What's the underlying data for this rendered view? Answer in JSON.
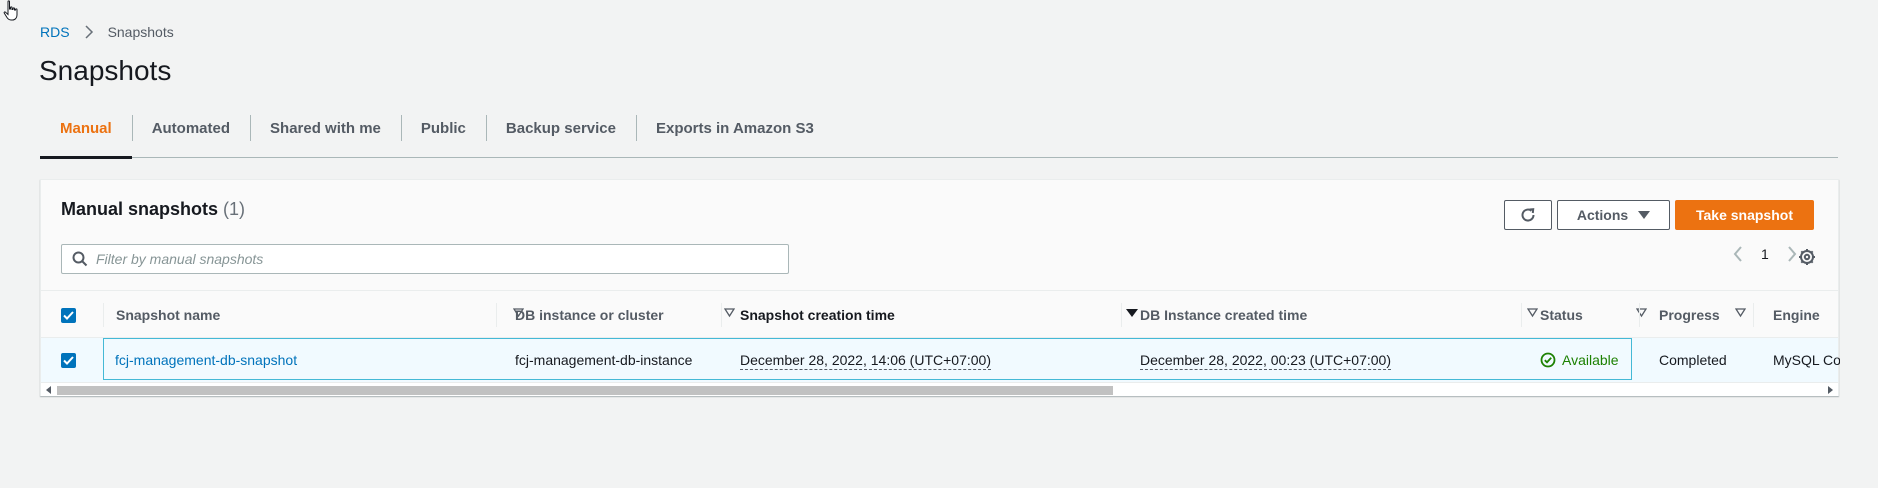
{
  "breadcrumb": {
    "parent": "RDS",
    "current": "Snapshots"
  },
  "page_title": "Snapshots",
  "tabs": [
    {
      "label": "Manual",
      "active": true
    },
    {
      "label": "Automated"
    },
    {
      "label": "Shared with me"
    },
    {
      "label": "Public"
    },
    {
      "label": "Backup service"
    },
    {
      "label": "Exports in Amazon S3"
    }
  ],
  "panel": {
    "title": "Manual snapshots",
    "count": "(1)",
    "actions_label": "Actions",
    "primary_label": "Take snapshot",
    "search_placeholder": "Filter by manual snapshots",
    "page_number": "1"
  },
  "table": {
    "columns": [
      "Snapshot name",
      "DB instance or cluster",
      "Snapshot creation time",
      "DB Instance created time",
      "Status",
      "Progress",
      "Engine"
    ],
    "rows": [
      {
        "snapshot_name": "fcj-management-db-snapshot",
        "db_instance": "fcj-management-db-instance",
        "creation_time": "December 28, 2022, 14:06 (UTC+07:00)",
        "instance_created": "December 28, 2022, 00:23 (UTC+07:00)",
        "status": "Available",
        "progress": "Completed",
        "engine": "MySQL Co"
      }
    ]
  },
  "colors": {
    "accent": "#ec7211",
    "link": "#0073bb",
    "success": "#1d8102"
  }
}
